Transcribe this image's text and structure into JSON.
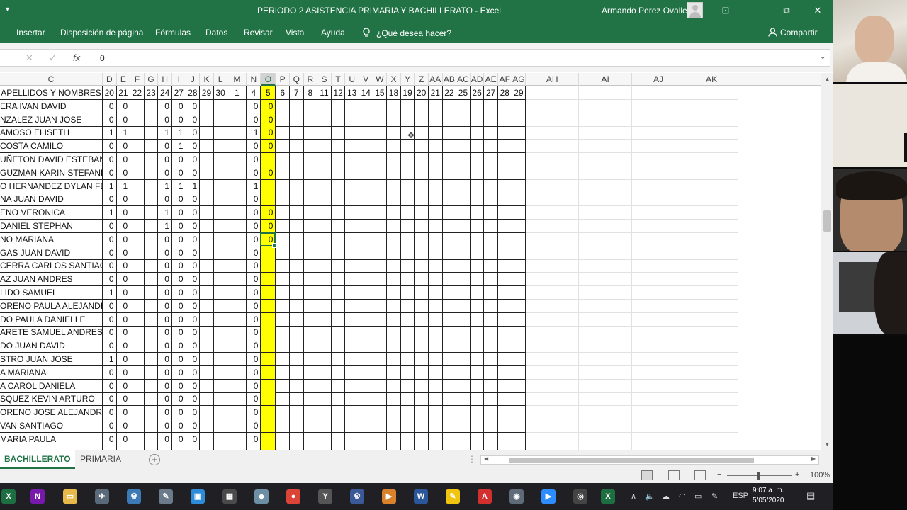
{
  "window": {
    "title": "PERIODO 2 ASISTENCIA PRIMARIA Y BACHILLERATO  -  Excel",
    "user": "Armando Perez Ovalle",
    "controls": {
      "ribbon_display": "⊡",
      "minimize": "—",
      "restore": "⧉",
      "close": "✕"
    },
    "qat_caret": "▾"
  },
  "ribbon": {
    "tabs": [
      "Insertar",
      "Disposición de página",
      "Fórmulas",
      "Datos",
      "Revisar",
      "Vista",
      "Ayuda"
    ],
    "tell_me": "¿Qué desea hacer?",
    "share": "Compartir"
  },
  "formula_bar": {
    "cancel": "✕",
    "enter": "✓",
    "fx": "fx",
    "content": "0",
    "expand": "⌄"
  },
  "columns": [
    {
      "letter": "C",
      "day": "APELLIDOS Y NOMBRES"
    },
    {
      "letter": "D",
      "day": "20"
    },
    {
      "letter": "E",
      "day": "21"
    },
    {
      "letter": "F",
      "day": "22"
    },
    {
      "letter": "G",
      "day": "23"
    },
    {
      "letter": "H",
      "day": "24"
    },
    {
      "letter": "I",
      "day": "27"
    },
    {
      "letter": "J",
      "day": "28"
    },
    {
      "letter": "K",
      "day": "29"
    },
    {
      "letter": "L",
      "day": "30"
    },
    {
      "letter": "M",
      "day": "1"
    },
    {
      "letter": "N",
      "day": "4"
    },
    {
      "letter": "O",
      "day": "5"
    },
    {
      "letter": "P",
      "day": "6"
    },
    {
      "letter": "Q",
      "day": "7"
    },
    {
      "letter": "R",
      "day": "8"
    },
    {
      "letter": "S",
      "day": "11"
    },
    {
      "letter": "T",
      "day": "12"
    },
    {
      "letter": "U",
      "day": "13"
    },
    {
      "letter": "V",
      "day": "14"
    },
    {
      "letter": "W",
      "day": "15"
    },
    {
      "letter": "X",
      "day": "18"
    },
    {
      "letter": "Y",
      "day": "19"
    },
    {
      "letter": "Z",
      "day": "20"
    },
    {
      "letter": "AA",
      "day": "21"
    },
    {
      "letter": "AB",
      "day": "22"
    },
    {
      "letter": "AC",
      "day": "25"
    },
    {
      "letter": "AD",
      "day": "26"
    },
    {
      "letter": "AE",
      "day": "27"
    },
    {
      "letter": "AF",
      "day": "28"
    },
    {
      "letter": "AG",
      "day": "29"
    },
    {
      "letter": "AH",
      "day": ""
    },
    {
      "letter": "AI",
      "day": ""
    },
    {
      "letter": "AJ",
      "day": ""
    },
    {
      "letter": "AK",
      "day": ""
    }
  ],
  "selected_column": "O",
  "students": [
    {
      "name": "ERA IVAN DAVID",
      "D": "0",
      "E": "0",
      "H": "0",
      "I": "0",
      "J": "0",
      "N": "0",
      "O": "0"
    },
    {
      "name": "NZALEZ JUAN JOSE",
      "D": "0",
      "E": "0",
      "H": "0",
      "I": "0",
      "J": "0",
      "N": "0",
      "O": "0"
    },
    {
      "name": "AMOSO ELISETH",
      "D": "1",
      "E": "1",
      "H": "1",
      "I": "1",
      "J": "0",
      "N": "1",
      "O": "0"
    },
    {
      "name": "COSTA CAMILO",
      "D": "0",
      "E": "0",
      "H": "0",
      "I": "1",
      "J": "0",
      "N": "0",
      "O": "0"
    },
    {
      "name": "UÑETON DAVID ESTEBAN",
      "D": "0",
      "E": "0",
      "H": "0",
      "I": "0",
      "J": "0",
      "N": "0",
      "O": ""
    },
    {
      "name": "GUZMAN KARIN STEFANNY",
      "D": "0",
      "E": "0",
      "H": "0",
      "I": "0",
      "J": "0",
      "N": "0",
      "O": "0"
    },
    {
      "name": "O HERNANDEZ DYLAN FELIPE",
      "D": "1",
      "E": "1",
      "H": "1",
      "I": "1",
      "J": "1",
      "N": "1",
      "O": ""
    },
    {
      "name": "NA JUAN DAVID",
      "D": "0",
      "E": "0",
      "H": "0",
      "I": "0",
      "J": "0",
      "N": "0",
      "O": ""
    },
    {
      "name": "ENO VERONICA",
      "D": "1",
      "E": "0",
      "H": "1",
      "I": "0",
      "J": "0",
      "N": "0",
      "O": "0"
    },
    {
      "name": " DANIEL STEPHAN",
      "D": "0",
      "E": "0",
      "H": "1",
      "I": "0",
      "J": "0",
      "N": "0",
      "O": "0"
    },
    {
      "name": "NO MARIANA",
      "D": "0",
      "E": "0",
      "H": "0",
      "I": "0",
      "J": "0",
      "N": "0",
      "O": "0"
    },
    {
      "name": "GAS JUAN DAVID",
      "D": "0",
      "E": "0",
      "H": "0",
      "I": "0",
      "J": "0",
      "N": "0",
      "O": ""
    },
    {
      "name": "CERRA CARLOS SANTIAGO",
      "D": "0",
      "E": "0",
      "H": "0",
      "I": "0",
      "J": "0",
      "N": "0",
      "O": ""
    },
    {
      "name": "AZ JUAN ANDRES",
      "D": "0",
      "E": "0",
      "H": "0",
      "I": "0",
      "J": "0",
      "N": "0",
      "O": ""
    },
    {
      "name": "LIDO SAMUEL",
      "D": "1",
      "E": "0",
      "H": "0",
      "I": "0",
      "J": "0",
      "N": "0",
      "O": ""
    },
    {
      "name": "ORENO PAULA ALEJANDRA",
      "D": "0",
      "E": "0",
      "H": "0",
      "I": "0",
      "J": "0",
      "N": "0",
      "O": ""
    },
    {
      "name": "DO PAULA DANIELLE",
      "D": "0",
      "E": "0",
      "H": "0",
      "I": "0",
      "J": "0",
      "N": "0",
      "O": ""
    },
    {
      "name": "ARETE SAMUEL ANDRES",
      "D": "0",
      "E": "0",
      "H": "0",
      "I": "0",
      "J": "0",
      "N": "0",
      "O": ""
    },
    {
      "name": "DO JUAN DAVID",
      "D": "0",
      "E": "0",
      "H": "0",
      "I": "0",
      "J": "0",
      "N": "0",
      "O": ""
    },
    {
      "name": "STRO JUAN JOSE",
      "D": "1",
      "E": "0",
      "H": "0",
      "I": "0",
      "J": "0",
      "N": "0",
      "O": ""
    },
    {
      "name": "A MARIANA",
      "D": "0",
      "E": "0",
      "H": "0",
      "I": "0",
      "J": "0",
      "N": "0",
      "O": ""
    },
    {
      "name": "A CAROL DANIELA",
      "D": "0",
      "E": "0",
      "H": "0",
      "I": "0",
      "J": "0",
      "N": "0",
      "O": ""
    },
    {
      "name": "SQUEZ KEVIN ARTURO",
      "D": "0",
      "E": "0",
      "H": "0",
      "I": "0",
      "J": "0",
      "N": "0",
      "O": ""
    },
    {
      "name": "ORENO JOSE ALEJANDRO",
      "D": "0",
      "E": "0",
      "H": "0",
      "I": "0",
      "J": "0",
      "N": "0",
      "O": ""
    },
    {
      "name": "VAN SANTIAGO",
      "D": "0",
      "E": "0",
      "H": "0",
      "I": "0",
      "J": "0",
      "N": "0",
      "O": ""
    },
    {
      "name": "MARIA PAULA",
      "D": "0",
      "E": "0",
      "H": "0",
      "I": "0",
      "J": "0",
      "N": "0",
      "O": ""
    },
    {
      "name": "",
      "D": "",
      "E": "",
      "H": "",
      "I": "",
      "J": "",
      "N": "",
      "O": ""
    }
  ],
  "active_cell": {
    "column": "O",
    "row_index": 10
  },
  "sheets": {
    "active": "BACHILLERATO",
    "other": "PRIMARIA",
    "add": "+"
  },
  "status": {
    "zoom": "100%",
    "zoom_minus": "−",
    "zoom_plus": "+"
  },
  "taskbar": {
    "lang": "ESP",
    "time": "9:07 a. m.",
    "date": "5/05/2020",
    "apps": [
      {
        "name": "excel-green-icon",
        "glyph": "X",
        "color": "#1d6f42"
      },
      {
        "name": "onenote-icon",
        "glyph": "N",
        "color": "#7719aa"
      },
      {
        "name": "file-explorer-icon",
        "glyph": "▭",
        "color": "#e8b84a"
      },
      {
        "name": "app-icon-1",
        "glyph": "✈",
        "color": "#5a6a7a"
      },
      {
        "name": "app-icon-2",
        "glyph": "⚙",
        "color": "#3c7ab5"
      },
      {
        "name": "app-icon-3",
        "glyph": "✎",
        "color": "#6b7b8b"
      },
      {
        "name": "app-icon-4",
        "glyph": "▣",
        "color": "#2e8bd8"
      },
      {
        "name": "calculator-icon",
        "glyph": "▦",
        "color": "#4a4a4a"
      },
      {
        "name": "app-icon-5",
        "glyph": "◆",
        "color": "#6d8fa6"
      },
      {
        "name": "chrome-icon",
        "glyph": "●",
        "color": "#db4437"
      },
      {
        "name": "app-icon-6",
        "glyph": "Y",
        "color": "#555"
      },
      {
        "name": "app-icon-7",
        "glyph": "⚙",
        "color": "#3b5998"
      },
      {
        "name": "app-icon-8",
        "glyph": "▶",
        "color": "#d9822b"
      },
      {
        "name": "word-icon",
        "glyph": "W",
        "color": "#2b579a"
      },
      {
        "name": "sticky-notes-icon",
        "glyph": "✎",
        "color": "#f1c40f"
      },
      {
        "name": "pdf-icon",
        "glyph": "A",
        "color": "#d32f2f"
      },
      {
        "name": "camera-icon",
        "glyph": "◉",
        "color": "#5f6b78"
      },
      {
        "name": "zoom-icon",
        "glyph": "▶",
        "color": "#2d8cff"
      },
      {
        "name": "app-icon-9",
        "glyph": "◎",
        "color": "#444"
      },
      {
        "name": "excel-active-icon",
        "glyph": "X",
        "color": "#1d6f42"
      }
    ]
  },
  "colors": {
    "excel_green": "#217346",
    "highlight": "#ffff00",
    "border_dark": "#222222"
  }
}
